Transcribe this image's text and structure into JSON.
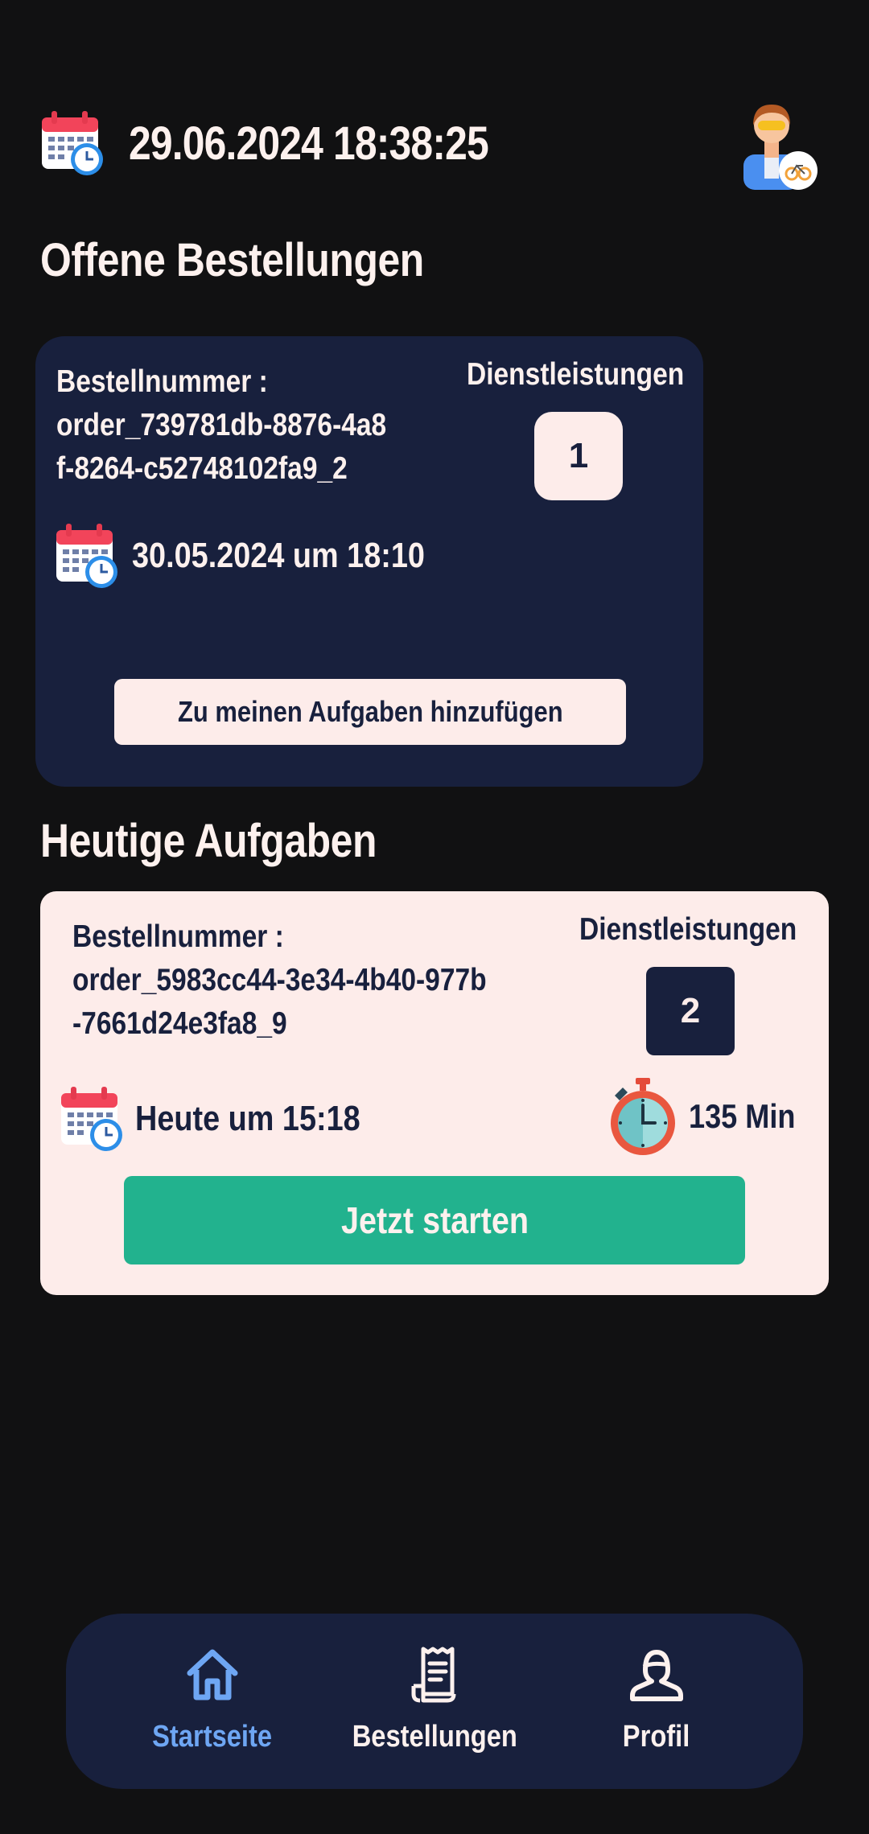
{
  "header": {
    "datetime": "29.06.2024 18:38:25",
    "calendar_icon": "calendar-clock-icon",
    "avatar_icon": "courier-avatar-icon"
  },
  "open_orders": {
    "title": "Offene Bestellungen",
    "card": {
      "order_label": "Bestellnummer :",
      "order_line1": "order_739781db-8876-4a8",
      "order_line2": "f-8264-c52748102fa9_2",
      "services_label": "Dienstleistungen",
      "services_count": "1",
      "date": "30.05.2024 um 18:10",
      "button_label": "Zu meinen Aufgaben hinzufügen"
    }
  },
  "today_tasks": {
    "title": "Heutige Aufgaben",
    "card": {
      "order_label": "Bestellnummer :",
      "order_line1": "order_5983cc44-3e34-4b40-977b",
      "order_line2": "-7661d24e3fa8_9",
      "services_label": "Dienstleistungen",
      "services_count": "2",
      "date": "Heute um 15:18",
      "duration": "135 Min",
      "button_label": "Jetzt starten"
    }
  },
  "bottom_nav": {
    "items": [
      {
        "label": "Startseite",
        "icon": "home-icon",
        "active": true
      },
      {
        "label": "Bestellungen",
        "icon": "receipt-icon",
        "active": false
      },
      {
        "label": "Profil",
        "icon": "user-icon",
        "active": false
      }
    ]
  },
  "colors": {
    "background": "#111112",
    "card_dark": "#18203d",
    "card_light": "#fdecea",
    "accent_green": "#22b28e",
    "nav_active": "#6ea6f3"
  }
}
